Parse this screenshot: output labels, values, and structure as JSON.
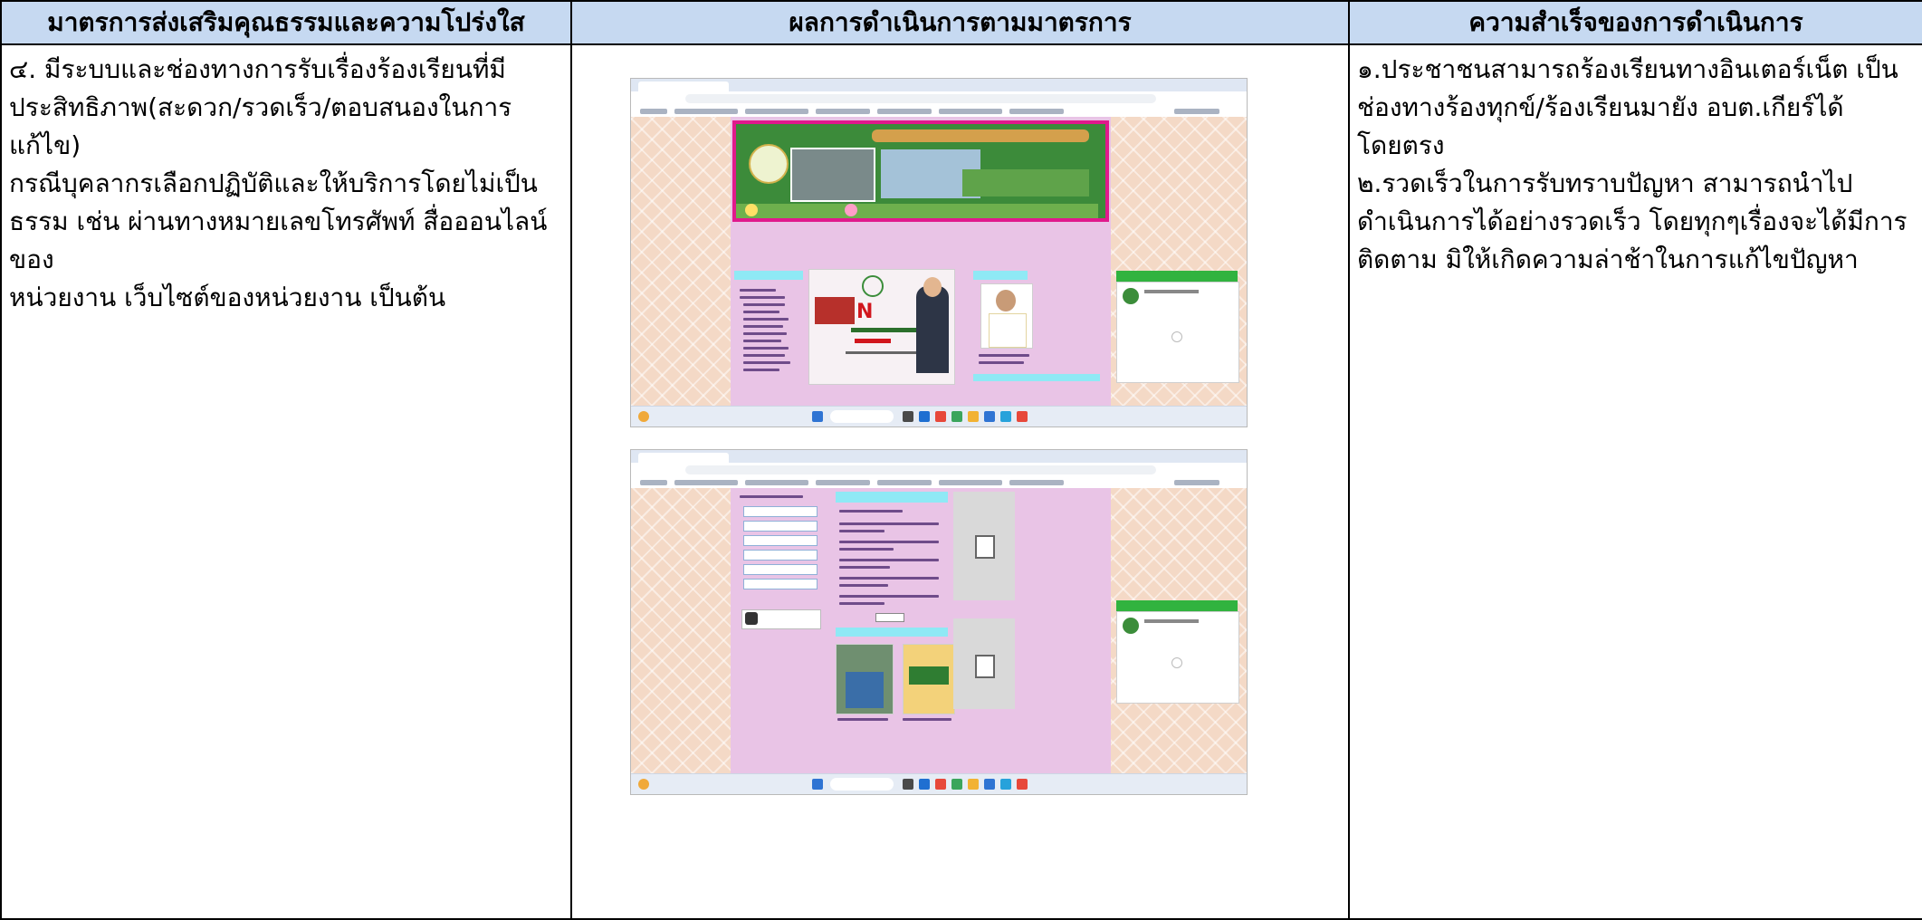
{
  "headers": {
    "col1": "มาตรการส่งเสริมคุณธรรมและความโปร่งใส",
    "col2": "ผลการดำเนินการตามมาตรการ",
    "col3": "ความสำเร็จของการดำเนินการ"
  },
  "col1_lines": [
    "๔. มีระบบและช่องทางการรับเรื่องร้องเรียนที่มี",
    "ประสิทธิภาพ(สะดวก/รวดเร็ว/ตอบสนองในการแก้ไข)",
    "กรณีบุคลากรเลือกปฏิบัติและให้บริการโดยไม่เป็น",
    "ธรรม เช่น ผ่านทางหมายเลขโทรศัพท์ สื่อออนไลน์ของ",
    "หน่วยงาน เว็บไซต์ของหน่วยงาน เป็นต้น"
  ],
  "col3_lines": [
    "๑.ประชาชนสามารถร้องเรียนทางอินเตอร์เน็ต เป็น",
    "ช่องทางร้องทุกข์/ร้องเรียนมายัง อบต.เกียร์ได้โดยตรง",
    "๒.รวดเร็วในการรับทราบปัญหา สามารถนำไป",
    "ดำเนินการได้อย่างรวดเร็ว โดยทุกๆเรื่องจะได้มีการ",
    "ติดตาม มิให้เกิดความล่าช้าในการแก้ไขปัญหา"
  ],
  "screenshots": [
    {
      "name": "website-homepage-screenshot"
    },
    {
      "name": "website-complaint-page-screenshot"
    }
  ],
  "colors": {
    "header_bg": "#c6d9f1",
    "page_pink": "#e9c4e6",
    "accent_green": "#31b33f",
    "accent_cyan": "#8fe9f5"
  }
}
